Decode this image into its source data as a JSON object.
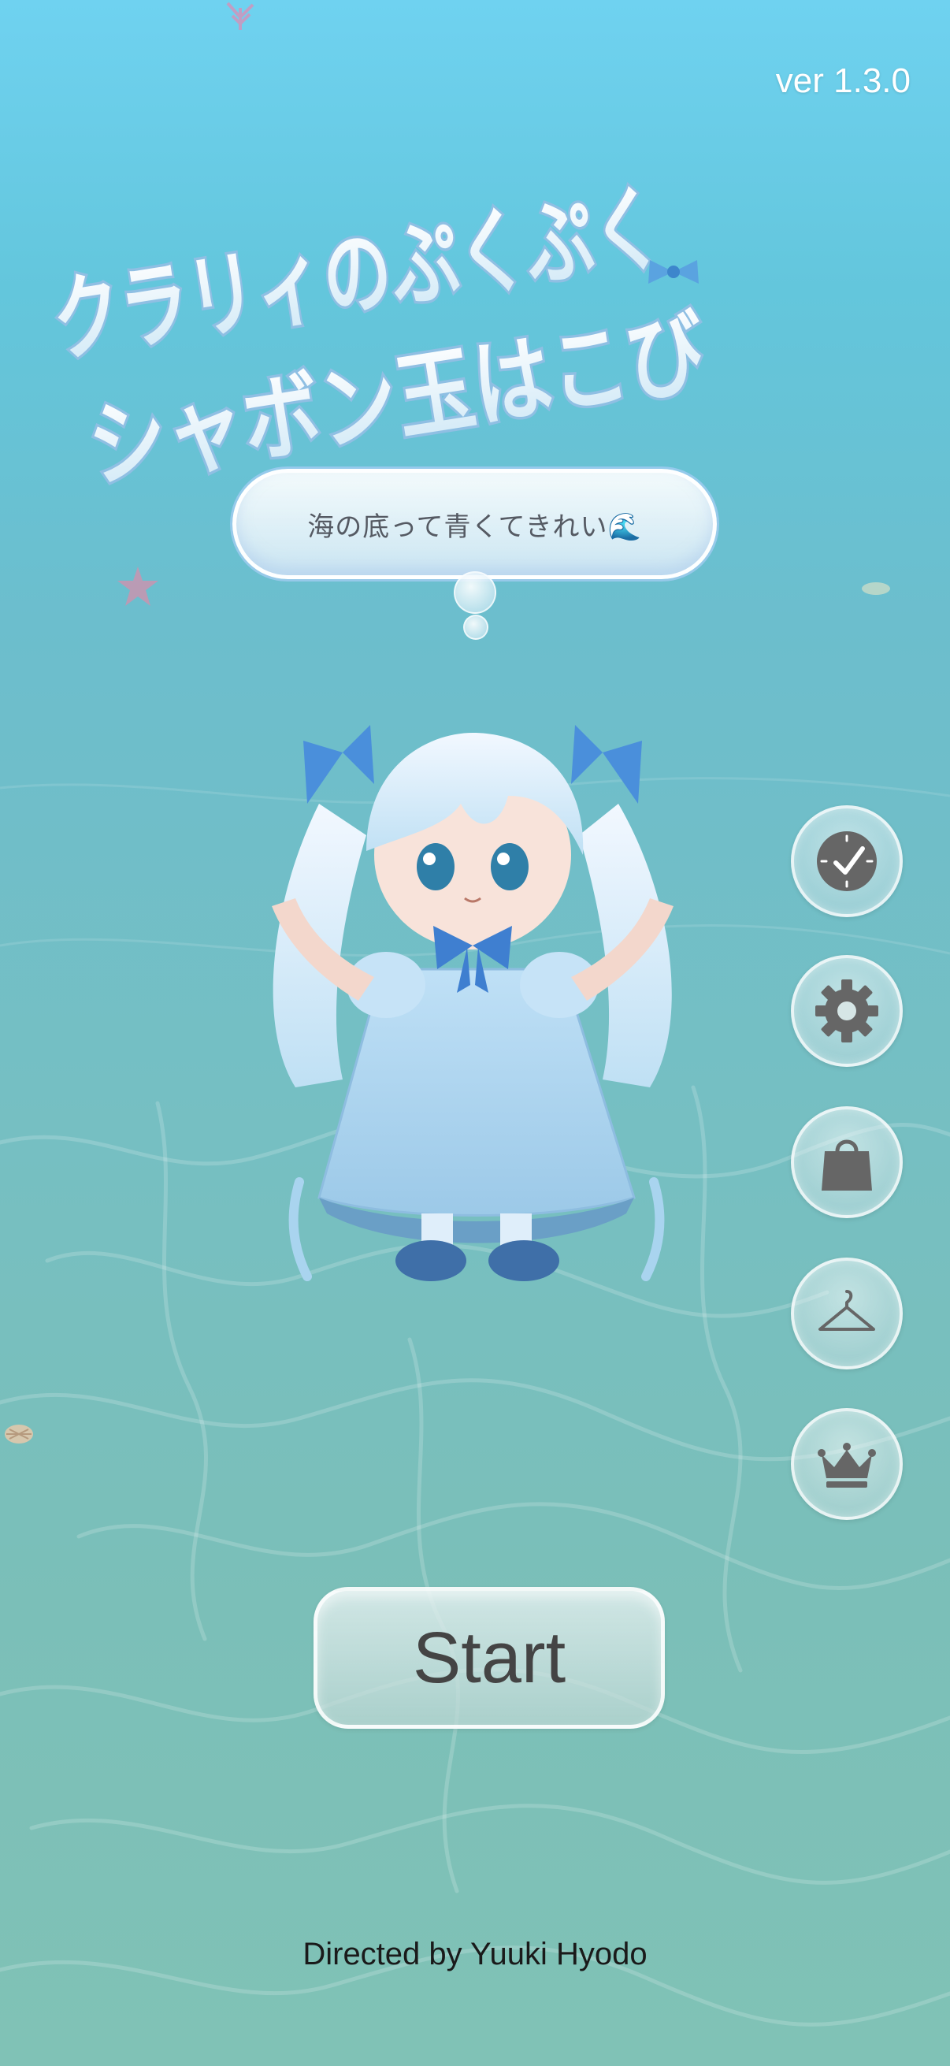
{
  "version": "ver 1.3.0",
  "logo": {
    "line1": "クラリィのぷくぷく",
    "line2": "シャボン玉はこび"
  },
  "speech_bubble": {
    "text": "海の底って青くてきれい🌊"
  },
  "side_menu": [
    {
      "id": "clock",
      "icon": "clock-icon"
    },
    {
      "id": "settings",
      "icon": "gear-icon"
    },
    {
      "id": "shop",
      "icon": "shopping-bag-icon"
    },
    {
      "id": "wardrobe",
      "icon": "hanger-icon"
    },
    {
      "id": "ranking",
      "icon": "crown-icon"
    }
  ],
  "start_button": {
    "label": "Start"
  },
  "credit": "Directed by Yuuki Hyodo",
  "colors": {
    "water_top": "#6fd2f0",
    "water_bottom": "#80c2b6",
    "icon_gray": "#666666",
    "logo_fill": "#e8f5fb",
    "logo_stroke": "#9cc8e8"
  }
}
